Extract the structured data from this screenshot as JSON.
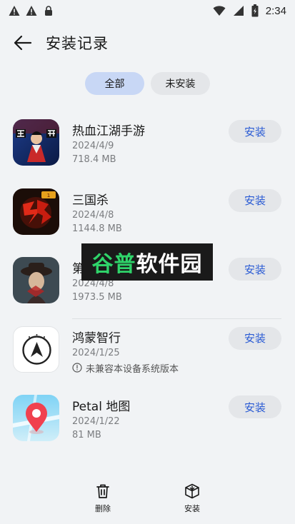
{
  "status_bar": {
    "time": "2:34",
    "left_icons": [
      "warning-icon",
      "warning-icon",
      "lock-icon"
    ],
    "right_icons": [
      "wifi-icon",
      "signal-icon",
      "battery-icon"
    ]
  },
  "header": {
    "title": "安装记录"
  },
  "filters": {
    "all": "全部",
    "not_installed": "未安装",
    "active": "all"
  },
  "apps": [
    {
      "name": "热血江湖手游",
      "date": "2024/4/9",
      "size": "718.4 MB",
      "button": "安装",
      "icon": "game-icon"
    },
    {
      "name": "三国杀",
      "date": "2024/4/8",
      "size": "1144.8 MB",
      "button": "安装",
      "icon": "game-icon"
    },
    {
      "name": "第",
      "date": "2024/4/8",
      "size": "1973.5 MB",
      "button": "安装",
      "icon": "game-icon"
    },
    {
      "name": "鸿蒙智行",
      "date": "2024/1/25",
      "note": "未兼容本设备系统版本",
      "button": "安装",
      "icon": "hima-icon"
    },
    {
      "name": "Petal 地图",
      "date": "2024/1/22",
      "size": "81 MB",
      "button": "安装",
      "icon": "map-pin-icon"
    }
  ],
  "watermark": {
    "green": "谷普",
    "white": "软件园"
  },
  "bottom_bar": {
    "delete": "删除",
    "install": "安装"
  },
  "colors": {
    "accent": "#2a5bd4",
    "chip_active": "#c8d7f5",
    "background": "#f1f3f5"
  }
}
